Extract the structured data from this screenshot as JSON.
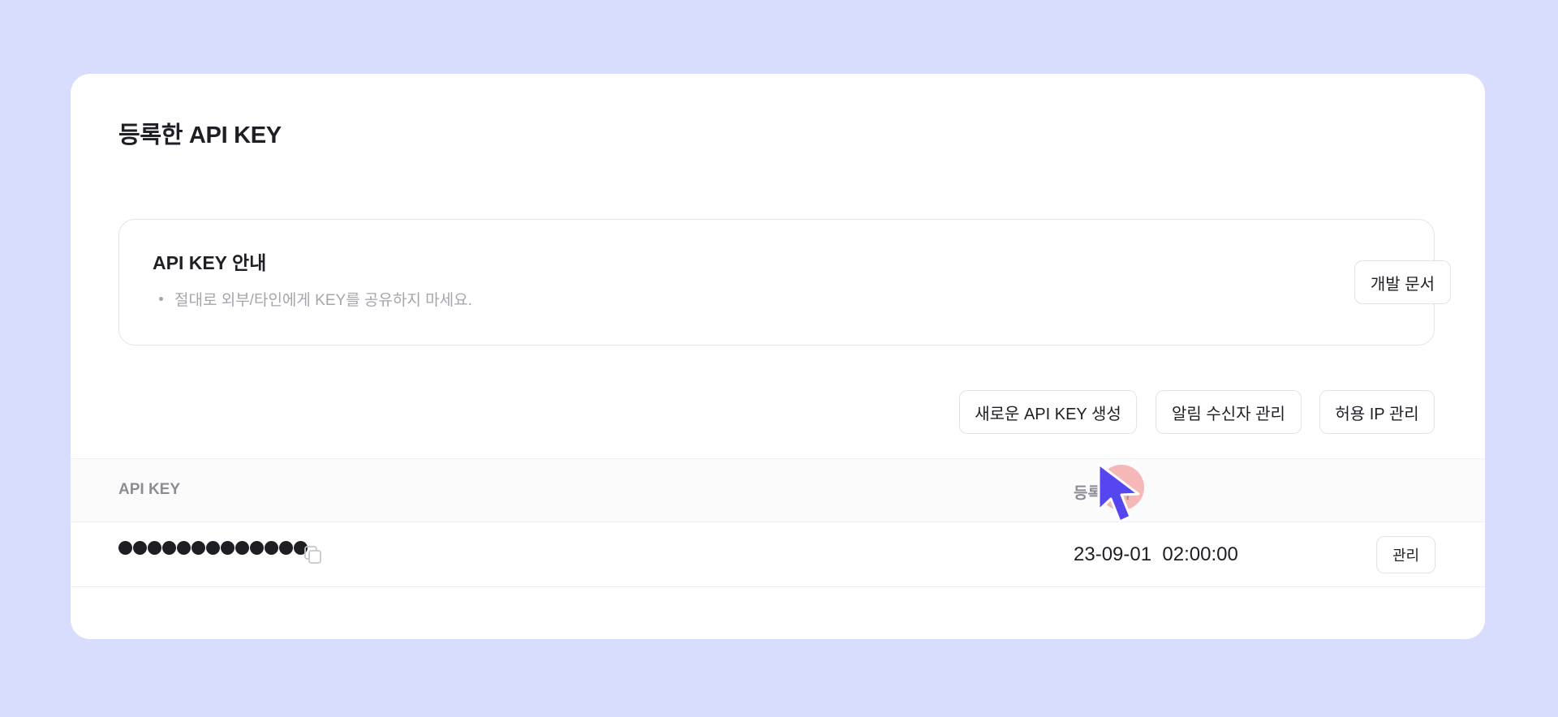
{
  "page": {
    "title": "등록한 API KEY"
  },
  "notice": {
    "title": "API KEY 안내",
    "bullet": "절대로 외부/타인에게 KEY를 공유하지 마세요.",
    "docs_button": "개발 문서"
  },
  "actions": {
    "new_key": "새로운 API KEY 생성",
    "recipients": "알림 수신자 관리",
    "allowed_ip": "허용 IP 관리"
  },
  "table": {
    "headers": {
      "key": "API KEY",
      "registered_at": "등록일시"
    },
    "rows": [
      {
        "masked_key": "●●●●●●●●●●●●●",
        "registered_at": "23-09-01  02:00:00",
        "manage_label": "관리"
      }
    ]
  },
  "icons": {
    "copy": "copy-icon",
    "cursor": "mouse-pointer-icon"
  },
  "colors": {
    "background": "#d8dcfd",
    "card": "#ffffff",
    "cursor": "#5546f0",
    "click_highlight": "#f08080"
  }
}
